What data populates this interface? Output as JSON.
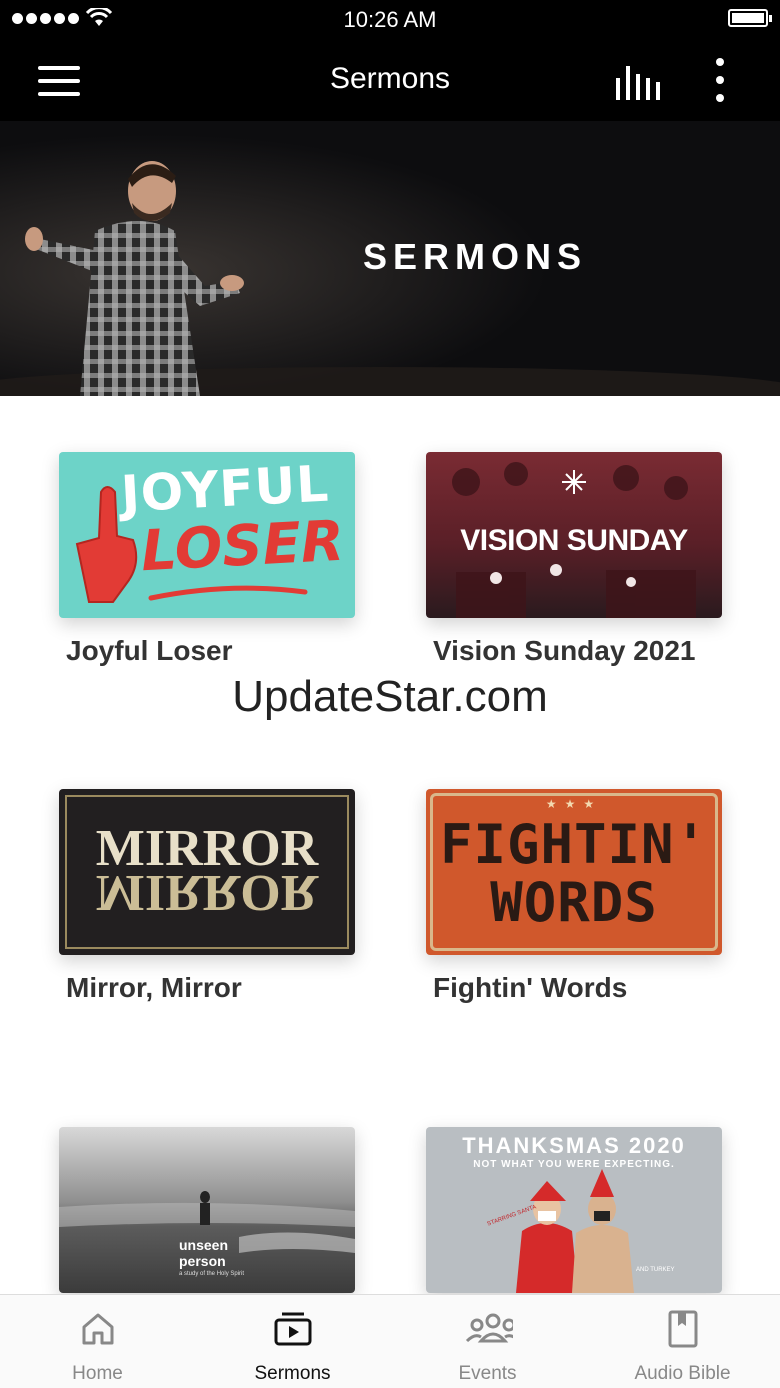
{
  "status_bar": {
    "time": "10:26 AM"
  },
  "navbar": {
    "title": "Sermons"
  },
  "hero": {
    "title": "SERMONS"
  },
  "watermark": "UpdateStar.com",
  "series": [
    {
      "label": "Joyful Loser",
      "art_line1": "JOYFUL",
      "art_line2": "LOSER"
    },
    {
      "label": "Vision Sunday 2021",
      "art_line1": "VISION SUNDAY"
    },
    {
      "label": "Mirror, Mirror",
      "art_line1": "MIRROR",
      "art_line2": "MIRROR"
    },
    {
      "label": "Fightin' Words",
      "art_line1": "FIGHTIN'",
      "art_line2": "WORDS"
    },
    {
      "label": "",
      "art_line1": "unseen",
      "art_line2": "person",
      "art_line3": "a study of the Holy Spirit"
    },
    {
      "label": "",
      "art_line1": "THANKSMAS 2020",
      "art_line2": "NOT WHAT YOU WERE EXPECTING.",
      "art_line3": "STARRING SANTA",
      "art_line4": "AND TURKEY"
    }
  ],
  "tabs": [
    {
      "label": "Home",
      "icon": "home-icon",
      "active": false
    },
    {
      "label": "Sermons",
      "icon": "sermons-icon",
      "active": true
    },
    {
      "label": "Events",
      "icon": "events-icon",
      "active": false
    },
    {
      "label": "Audio Bible",
      "icon": "audio-bible-icon",
      "active": false
    }
  ],
  "colors": {
    "bar_bg": "#000000",
    "joyful_bg": "#6dd3c8",
    "joyful_accent": "#e23b35",
    "fightin_bg": "#d0582c",
    "tab_active": "#111111",
    "tab_inactive": "#888888"
  }
}
